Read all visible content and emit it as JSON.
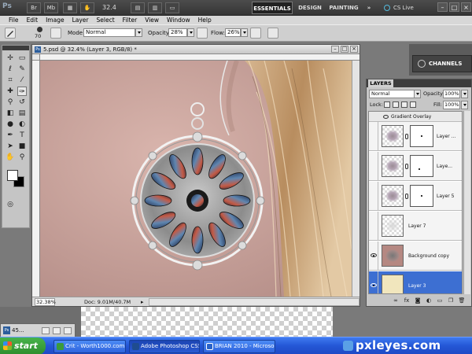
{
  "appbar": {
    "logo": "Ps",
    "buttons": [
      "Br",
      "Mb"
    ],
    "zoom": "32.4",
    "workspaces": [
      "ESSENTIALS",
      "DESIGN",
      "PAINTING"
    ],
    "more": "»",
    "cslive": "CS Live",
    "window_controls": [
      "–",
      "□",
      "×"
    ]
  },
  "menu": [
    "File",
    "Edit",
    "Image",
    "Layer",
    "Select",
    "Filter",
    "View",
    "Window",
    "Help"
  ],
  "options": {
    "brush_size": "70",
    "mode_label": "Mode:",
    "mode_value": "Normal",
    "opacity_label": "Opacity:",
    "opacity_value": "28%",
    "flow_label": "Flow:",
    "flow_value": "26%"
  },
  "document": {
    "title": "5.psd @ 32.4% (Layer 3, RGB/8) *",
    "zoom": "32.38%",
    "doc_size": "Doc: 9.01M/40.7M",
    "controls": [
      "–",
      "□",
      "×"
    ]
  },
  "channels_tab": "CHANNELS",
  "layers_panel": {
    "tab": "LAYERS",
    "blend_mode": "Normal",
    "opacity_label": "Opacity:",
    "opacity_value": "100%",
    "lock_label": "Lock:",
    "fill_label": "Fill:",
    "fill_value": "100%",
    "effect_label": "Gradient Overlay",
    "layers": [
      {
        "name": "Layer ...",
        "visible": false,
        "selected": false
      },
      {
        "name": "Laye...",
        "visible": false,
        "selected": false
      },
      {
        "name": "Layer 5",
        "visible": false,
        "selected": false
      },
      {
        "name": "Layer 7",
        "visible": false,
        "selected": false
      },
      {
        "name": "Background copy",
        "visible": true,
        "selected": false
      },
      {
        "name": "Layer 3",
        "visible": true,
        "selected": true
      }
    ],
    "footer_icons": [
      "link-icon",
      "fx-icon",
      "mask-icon",
      "adjustment-icon",
      "folder-icon",
      "new-layer-icon",
      "trash-icon"
    ]
  },
  "minimized_doc": "45...",
  "taskbar": {
    "start": "start",
    "tasks": [
      "Crit - Worth1000.com...",
      "Adobe Photoshop CS5",
      "BRIAN 2010 - Microso..."
    ],
    "active_index": 1
  },
  "watermark": "pxleyes.com"
}
